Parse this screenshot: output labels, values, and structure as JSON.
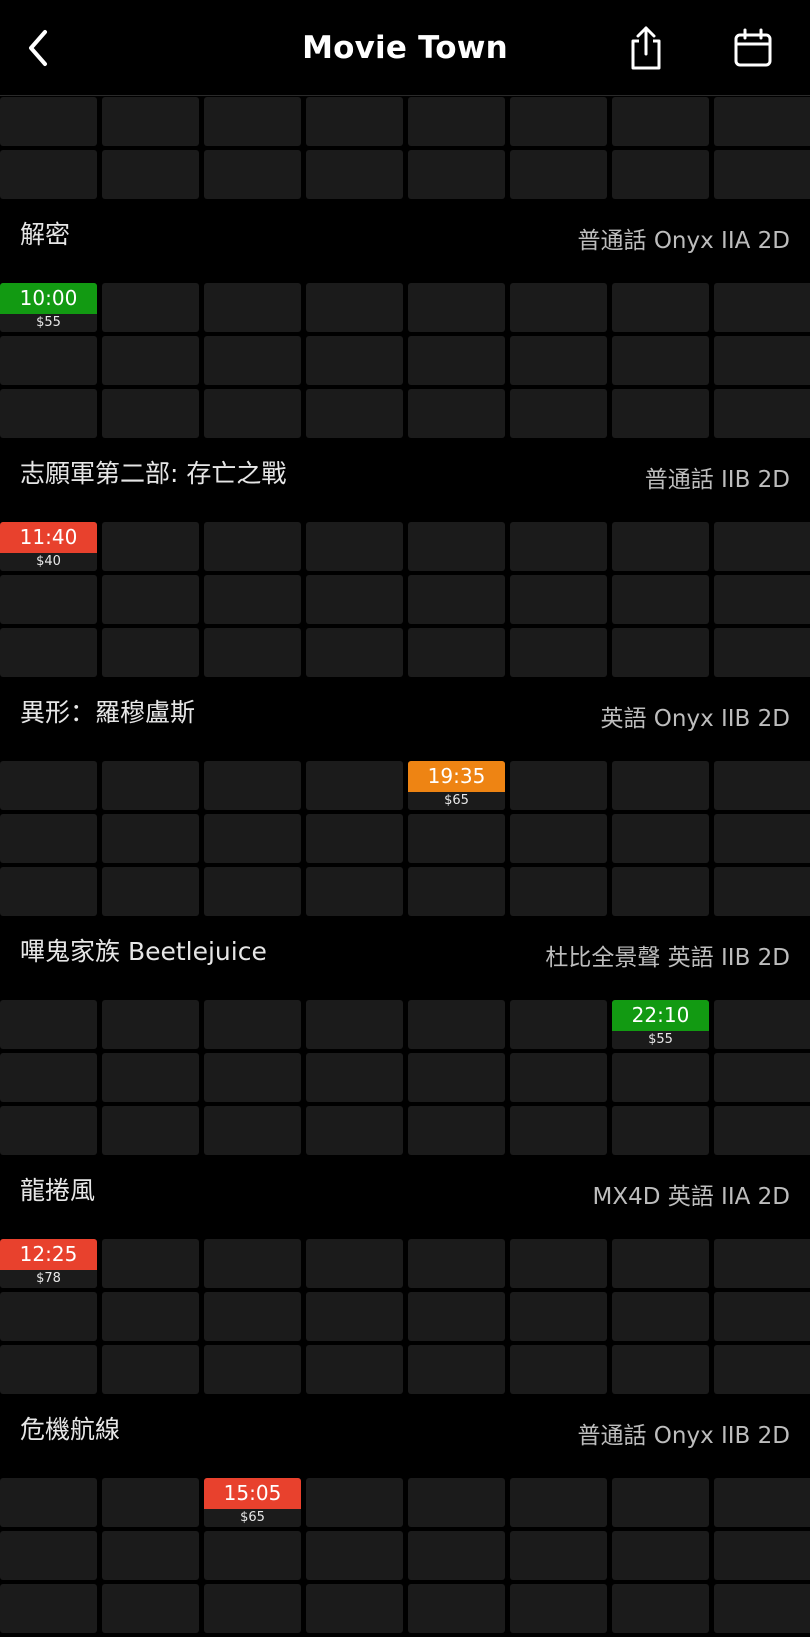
{
  "header": {
    "title": "Movie Town",
    "icons": {
      "back": "chevron-left-icon",
      "share": "share-icon",
      "calendar": "calendar-icon"
    }
  },
  "colors": {
    "green": "#129a12",
    "red": "#e8412d",
    "orange": "#ee8413",
    "cell": "#1b1b1b",
    "background": "#000000"
  },
  "top_grid": {
    "rows": 2
  },
  "movies": [
    {
      "title": "解密",
      "meta": "普通話 Onyx IIA 2D",
      "rows": 3,
      "slots": [
        {
          "row": 0,
          "col": 0,
          "time": "10:00",
          "price": "$55",
          "color": "green"
        }
      ]
    },
    {
      "title": "志願軍第二部: 存亡之戰",
      "meta": "普通話 IIB 2D",
      "rows": 3,
      "slots": [
        {
          "row": 0,
          "col": 0,
          "time": "11:40",
          "price": "$40",
          "color": "red"
        }
      ]
    },
    {
      "title": "異形：羅穆盧斯",
      "meta": "英語 Onyx IIB 2D",
      "rows": 3,
      "slots": [
        {
          "row": 0,
          "col": 4,
          "time": "19:35",
          "price": "$65",
          "color": "orange"
        }
      ]
    },
    {
      "title": "嗶鬼家族 Beetlejuice",
      "meta": "杜比全景聲 英語 IIB 2D",
      "rows": 3,
      "slots": [
        {
          "row": 0,
          "col": 6,
          "time": "22:10",
          "price": "$55",
          "color": "green"
        }
      ]
    },
    {
      "title": "龍捲風",
      "meta": "MX4D 英語 IIA 2D",
      "rows": 3,
      "slots": [
        {
          "row": 0,
          "col": 0,
          "time": "12:25",
          "price": "$78",
          "color": "red"
        }
      ]
    },
    {
      "title": "危機航線",
      "meta": "普通話 Onyx IIB 2D",
      "rows": 3,
      "slots": [
        {
          "row": 0,
          "col": 2,
          "time": "15:05",
          "price": "$65",
          "color": "red"
        }
      ]
    }
  ]
}
